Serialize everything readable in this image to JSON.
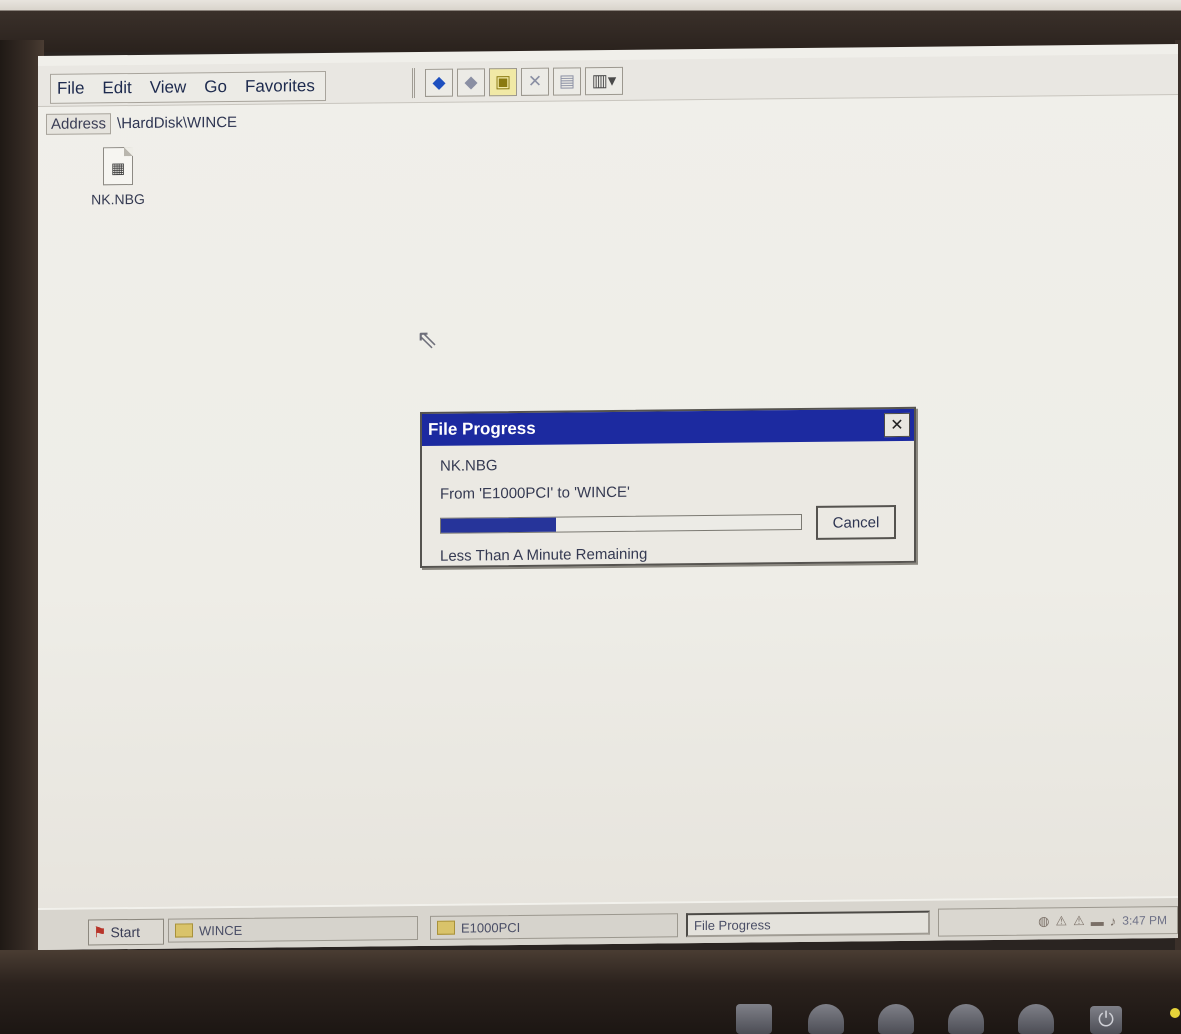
{
  "menu": {
    "items": [
      "File",
      "Edit",
      "View",
      "Go",
      "Favorites"
    ]
  },
  "toolbar": {
    "buttons": [
      {
        "icon": "back-arrow-icon",
        "glyph": "◆"
      },
      {
        "icon": "forward-arrow-icon",
        "glyph": "◆"
      },
      {
        "icon": "up-folder-icon",
        "glyph": "▣"
      },
      {
        "icon": "delete-icon",
        "glyph": "✕"
      },
      {
        "icon": "properties-icon",
        "glyph": "▤"
      },
      {
        "icon": "views-icon",
        "glyph": "▥▾"
      }
    ]
  },
  "address": {
    "label": "Address",
    "value": "\\HardDisk\\WINCE"
  },
  "desktop": {
    "files": [
      {
        "name": "NK.NBG",
        "icon": "file-document-icon"
      }
    ]
  },
  "dialog": {
    "title": "File Progress",
    "close_glyph": "✕",
    "file_name": "NK.NBG",
    "from_to": "From 'E1000PCI' to 'WINCE'",
    "progress": 0.32,
    "cancel_label": "Cancel",
    "time_remaining": "Less Than A Minute Remaining"
  },
  "taskbar": {
    "start_label": "Start",
    "tasks": [
      {
        "label": "WINCE"
      },
      {
        "label": "E1000PCI"
      },
      {
        "label": "File Progress"
      }
    ],
    "clock": "3:47 PM"
  },
  "colors": {
    "titlebar": "#1c2aa0",
    "progress_fill": "#26349a",
    "screen_bg": "#eeede7"
  }
}
